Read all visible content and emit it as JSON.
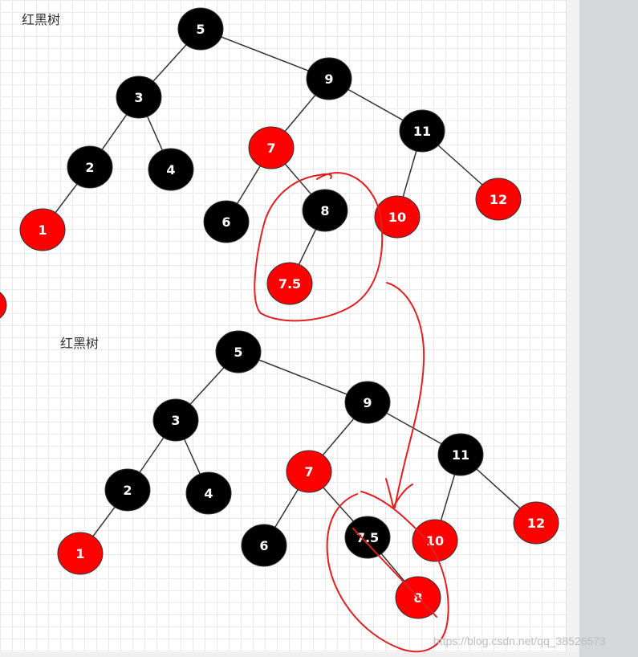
{
  "captions": {
    "top": "红黑树",
    "bottom": "红黑树"
  },
  "colors": {
    "black_node": "#000000",
    "red_node": "#ff0000",
    "node_text": "#ffffff",
    "edge": "#333333",
    "annotation": "#e02020"
  },
  "trees": [
    {
      "nodes": [
        {
          "id": "n5",
          "label": "5",
          "color": "black"
        },
        {
          "id": "n3",
          "label": "3",
          "color": "black"
        },
        {
          "id": "n9",
          "label": "9",
          "color": "black"
        },
        {
          "id": "n2",
          "label": "2",
          "color": "black"
        },
        {
          "id": "n4",
          "label": "4",
          "color": "black"
        },
        {
          "id": "n7",
          "label": "7",
          "color": "red"
        },
        {
          "id": "n11",
          "label": "11",
          "color": "black"
        },
        {
          "id": "n1",
          "label": "1",
          "color": "red"
        },
        {
          "id": "n6",
          "label": "6",
          "color": "black"
        },
        {
          "id": "n8",
          "label": "8",
          "color": "black"
        },
        {
          "id": "n10",
          "label": "10",
          "color": "red"
        },
        {
          "id": "n12",
          "label": "12",
          "color": "red"
        },
        {
          "id": "n75",
          "label": "7.5",
          "color": "red"
        }
      ],
      "edges": [
        [
          "n5",
          "n3"
        ],
        [
          "n5",
          "n9"
        ],
        [
          "n3",
          "n2"
        ],
        [
          "n3",
          "n4"
        ],
        [
          "n2",
          "n1"
        ],
        [
          "n9",
          "n7"
        ],
        [
          "n9",
          "n11"
        ],
        [
          "n7",
          "n6"
        ],
        [
          "n7",
          "n8"
        ],
        [
          "n11",
          "n10"
        ],
        [
          "n11",
          "n12"
        ],
        [
          "n8",
          "n75"
        ]
      ]
    },
    {
      "nodes": [
        {
          "id": "m5",
          "label": "5",
          "color": "black"
        },
        {
          "id": "m3",
          "label": "3",
          "color": "black"
        },
        {
          "id": "m9",
          "label": "9",
          "color": "black"
        },
        {
          "id": "m2",
          "label": "2",
          "color": "black"
        },
        {
          "id": "m4",
          "label": "4",
          "color": "black"
        },
        {
          "id": "m7",
          "label": "7",
          "color": "red"
        },
        {
          "id": "m11",
          "label": "11",
          "color": "black"
        },
        {
          "id": "m1",
          "label": "1",
          "color": "red"
        },
        {
          "id": "m6",
          "label": "6",
          "color": "black"
        },
        {
          "id": "m75",
          "label": "7.5",
          "color": "black"
        },
        {
          "id": "m10",
          "label": "10",
          "color": "red"
        },
        {
          "id": "m12",
          "label": "12",
          "color": "red"
        },
        {
          "id": "m8",
          "label": "8",
          "color": "red"
        }
      ],
      "edges": [
        [
          "m5",
          "m3"
        ],
        [
          "m5",
          "m9"
        ],
        [
          "m3",
          "m2"
        ],
        [
          "m3",
          "m4"
        ],
        [
          "m2",
          "m1"
        ],
        [
          "m9",
          "m7"
        ],
        [
          "m9",
          "m11"
        ],
        [
          "m7",
          "m6"
        ],
        [
          "m7",
          "m75"
        ],
        [
          "m11",
          "m10"
        ],
        [
          "m11",
          "m12"
        ],
        [
          "m75",
          "m8"
        ]
      ]
    }
  ],
  "watermark": "https://blog.csdn.net/qq_38526573"
}
